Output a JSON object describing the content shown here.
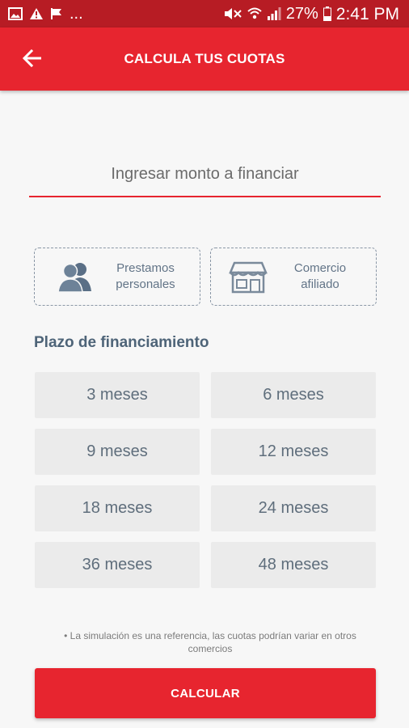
{
  "status_bar": {
    "dots": "...",
    "battery": "27%",
    "time": "2:41 PM",
    "icons": [
      "image-icon",
      "warning-icon",
      "flag-icon",
      "mute-icon",
      "wifi-icon",
      "signal-icon",
      "battery-icon"
    ]
  },
  "app_bar": {
    "title": "CALCULA TUS CUOTAS",
    "back_icon": "arrow-left-icon",
    "color": "#e7252f"
  },
  "amount": {
    "placeholder": "Ingresar monto a financiar",
    "value": ""
  },
  "loan_types": [
    {
      "label": "Prestamos personales",
      "icon": "people-icon"
    },
    {
      "label": "Comercio afiliado",
      "icon": "store-icon"
    }
  ],
  "term": {
    "title": "Plazo de financiamiento",
    "options": [
      "3 meses",
      "6 meses",
      "9 meses",
      "12 meses",
      "18 meses",
      "24 meses",
      "36 meses",
      "48 meses"
    ]
  },
  "disclaimer": "• La simulación es una referencia, las cuotas podrían variar en otros comercios",
  "calculate_label": "CALCULAR",
  "colors": {
    "accent": "#e7252f",
    "status_bar": "#b71c24",
    "section_text": "#4e6478"
  }
}
